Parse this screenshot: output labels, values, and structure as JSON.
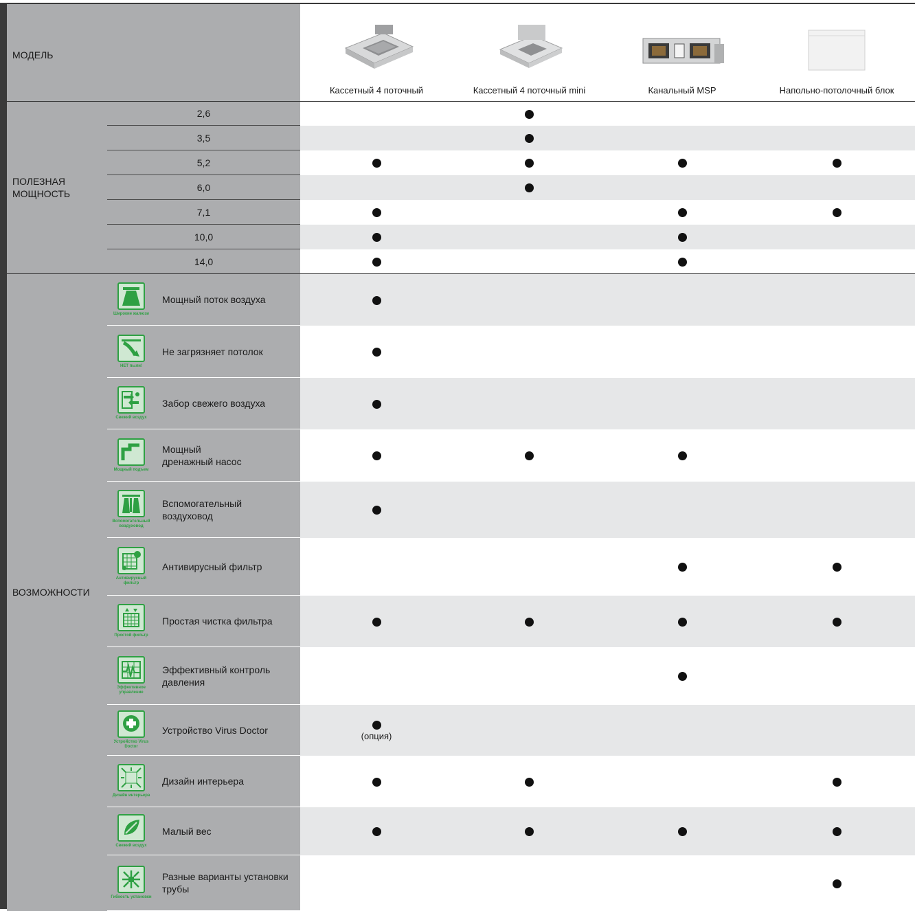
{
  "header": {
    "model_label": "МОДЕЛЬ",
    "products": [
      {
        "name": "Кассетный 4 поточный",
        "icon": "cassette-unit"
      },
      {
        "name": "Кассетный 4 поточный mini",
        "icon": "cassette-mini-unit"
      },
      {
        "name": "Канальный MSP",
        "icon": "duct-unit"
      },
      {
        "name": "Напольно-потолочный блок",
        "icon": "floor-ceiling-unit"
      }
    ]
  },
  "capacity": {
    "label": "ПОЛЕЗНАЯ\nМОЩНОСТЬ",
    "rows": [
      {
        "value": "2,6",
        "marks": [
          false,
          true,
          false,
          false
        ]
      },
      {
        "value": "3,5",
        "marks": [
          false,
          true,
          false,
          false
        ]
      },
      {
        "value": "5,2",
        "marks": [
          true,
          true,
          true,
          true
        ]
      },
      {
        "value": "6,0",
        "marks": [
          false,
          true,
          false,
          false
        ]
      },
      {
        "value": "7,1",
        "marks": [
          true,
          false,
          true,
          true
        ]
      },
      {
        "value": "10,0",
        "marks": [
          true,
          false,
          true,
          false
        ]
      },
      {
        "value": "14,0",
        "marks": [
          true,
          false,
          true,
          false
        ]
      }
    ]
  },
  "features": {
    "label": "ВОЗМОЖНОСТИ",
    "option_note": "(опция)",
    "rows": [
      {
        "label": "Мощный поток воздуха",
        "icon": "wide-louver-icon",
        "icon_caption": "Широкие жалюзи",
        "marks": [
          true,
          false,
          false,
          false
        ]
      },
      {
        "label": "Не загрязняет потолок",
        "icon": "no-dust-icon",
        "icon_caption": "НЕТ пыли!",
        "marks": [
          true,
          false,
          false,
          false
        ]
      },
      {
        "label": "Забор свежего воздуха",
        "icon": "fresh-air-icon",
        "icon_caption": "Свежий воздух",
        "marks": [
          true,
          false,
          false,
          false
        ]
      },
      {
        "label": "Мощный\nдренажный насос",
        "icon": "drain-pump-icon",
        "icon_caption": "Мощный подъем",
        "marks": [
          true,
          true,
          true,
          false
        ]
      },
      {
        "label": "Вспомогательный\nвоздуховод",
        "icon": "aux-duct-icon",
        "icon_caption": "Вспомогательный воздуховод",
        "marks": [
          true,
          false,
          false,
          false
        ]
      },
      {
        "label": "Антивирусный фильтр",
        "icon": "antivirus-filter-icon",
        "icon_caption": "Антивирусный фильтр",
        "marks": [
          false,
          false,
          true,
          true
        ]
      },
      {
        "label": "Простая чистка фильтра",
        "icon": "easy-filter-icon",
        "icon_caption": "Простой фильтр",
        "marks": [
          true,
          true,
          true,
          true
        ]
      },
      {
        "label": "Эффективный контроль\nдавления",
        "icon": "pressure-control-icon",
        "icon_caption": "Эффективное управление",
        "marks": [
          false,
          false,
          true,
          false
        ]
      },
      {
        "label": "Устройство Virus Doctor",
        "icon": "virus-doctor-icon",
        "icon_caption": "Устройство Virus Doctor",
        "marks": [
          "option",
          false,
          false,
          false
        ]
      },
      {
        "label": "Дизайн интерьера",
        "icon": "interior-design-icon",
        "icon_caption": "Дизайн интерьера",
        "marks": [
          true,
          true,
          false,
          true
        ]
      },
      {
        "label": "Малый вес",
        "icon": "light-weight-icon",
        "icon_caption": "Свежий воздух",
        "marks": [
          true,
          true,
          true,
          true
        ]
      },
      {
        "label": "Разные варианты установки\nтрубы",
        "icon": "flexible-install-icon",
        "icon_caption": "Гибкость установки",
        "marks": [
          false,
          false,
          false,
          true
        ]
      }
    ]
  },
  "colors": {
    "sidebar_grey": "#acadaf",
    "row_alt": "#e6e7e8",
    "icon_green": "#2ea043",
    "dot": "#111111"
  }
}
